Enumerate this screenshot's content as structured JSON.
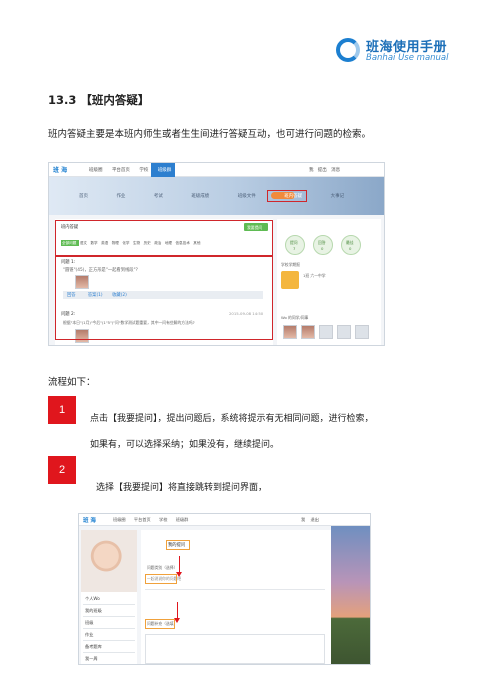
{
  "header": {
    "logo_cn": "班海使用手册",
    "logo_en": "Banhai Use manual",
    "logo_icon": "banhai-ring-logo",
    "brand_color": "#1c7fd0"
  },
  "section": {
    "title": "13.3 【班内答疑】",
    "intro": "班内答疑主要是本班内师生或者生生间进行答疑互动，也可进行问题的检索。"
  },
  "screenshot1": {
    "brand": "班 海",
    "menu": [
      "班级圈",
      "平台首页",
      "学校",
      "班级群"
    ],
    "topbar_right": [
      "我",
      "提出",
      "消息"
    ],
    "nav": [
      "首页",
      "作业",
      "考试",
      "班级成绩",
      "班级文件",
      "班内答疑",
      "大事记"
    ],
    "panel_title": "班内答疑",
    "ask_button": "我要提问",
    "tabs": [
      "全部问题",
      "语文",
      "数学",
      "英语",
      "物理",
      "化学",
      "生物",
      "历史",
      "政治",
      "地理",
      "信息技术",
      "其他"
    ],
    "q1_title": "问题 1:",
    "q1_text": "\"圆锥\"(45)，正方形是\"一起看到线段\"?",
    "q1_actions": [
      "回答",
      "答案(1)",
      "收藏(2)"
    ],
    "q2_title": "问题 2:",
    "q2_date": "2015-09-08 14:50",
    "q2_text": "根据\"本日\"(1月)\"今后\"(1\"5\")\"问\"数学测试题重要，其中一问有些解的方法吗?",
    "side_stats": [
      {
        "label": "提问",
        "value": "7"
      },
      {
        "label": "回答",
        "value": "0"
      },
      {
        "label": "最佳",
        "value": "0"
      }
    ],
    "side_section": "学校学期报",
    "side_item": "1班 六一中学",
    "side_people": "Wo 的同学/同事"
  },
  "flow": {
    "title": "流程如下：",
    "steps": [
      {
        "number": "1",
        "line1": "点击【我要提问】，提出问题后，系统将提示有无相同问题，进行检索，",
        "line2": "如果有，可以选择采纳；如果没有，继续提问。"
      },
      {
        "number": "2",
        "line1": "选择【我要提问】将直接跳转到提问界面，"
      }
    ],
    "badge_color": "#e0161d"
  },
  "screenshot2": {
    "brand": "班 海",
    "menu": [
      "班级圈",
      "平台首页",
      "学校",
      "班级群"
    ],
    "topbar_right": [
      "我",
      "退出"
    ],
    "panel_title": "我的提问",
    "hint": "问题类别（选择）",
    "input_hint": "一起说说你的问题吧",
    "desc_label": "问题补充（选填）",
    "left_items": [
      "个人Wo",
      "我的班级",
      "班级",
      "作业",
      "备考题库",
      "我一周"
    ]
  }
}
